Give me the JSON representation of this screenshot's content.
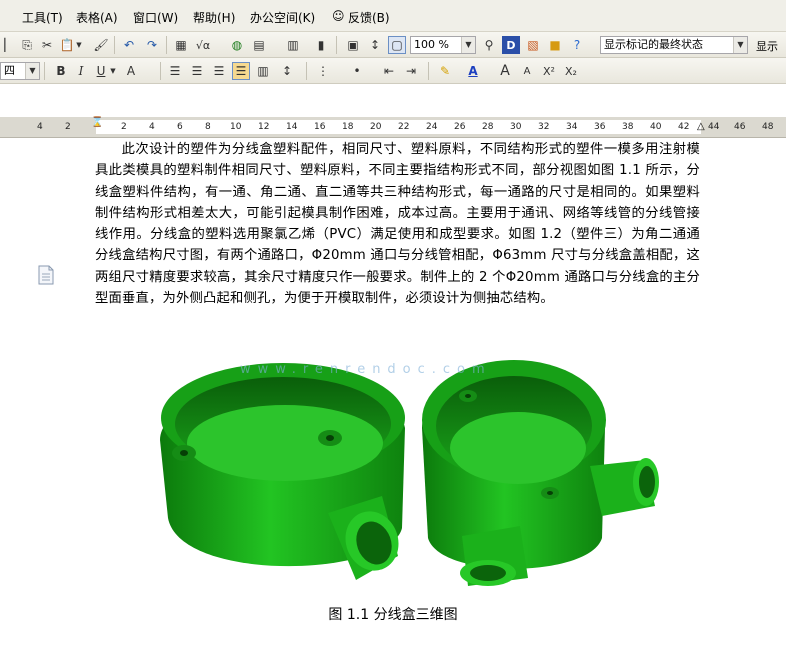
{
  "menubar": {
    "items": [
      "工具(T)",
      "表格(A)",
      "窗口(W)",
      "帮助(H)",
      "办公空间(K)",
      "反馈(B)"
    ]
  },
  "toolbar": {
    "zoom": "100 %",
    "markup_view": "显示标记的最终状态",
    "show_label": "显示",
    "font_size": "四"
  },
  "ruler": {
    "labels": [
      "4",
      "2",
      "2",
      "4",
      "6",
      "8",
      "10",
      "12",
      "14",
      "16",
      "18",
      "20",
      "22",
      "24",
      "26",
      "28",
      "30",
      "32",
      "34",
      "36",
      "38",
      "40",
      "42",
      "44",
      "46",
      "48"
    ]
  },
  "document": {
    "paragraph": "此次设计的塑件为分线盒塑料配件，相同尺寸、塑料原料，不同结构形式的塑件一模多用注射模具此类模具的塑料制件相同尺寸、塑料原料，不同主要指结构形式不同，部分视图如图 1.1 所示，分线盒塑料件结构，有一通、角二通、直二通等共三种结构形式，每一通路的尺寸是相同的。如果塑料制件结构形式相差太大，可能引起模具制作困难，成本过高。主要用于通讯、网络等线管的分线管接线作用。分线盒的塑料选用聚氯乙烯（PVC）满足使用和成型要求。如图 1.2（塑件三）为角二通通分线盒结构尺寸图，有两个通路口，Φ20mm 通口与分线管相配，Φ63mm 尺寸与分线盒盖相配，这两组尺寸精度要求较高，其余尺寸精度只作一般要求。制件上的 2 个Φ20mm 通路口与分线盒的主分型面垂直，为外侧凸起和侧孔，为便于开模取制件，必须设计为侧抽芯结构。",
    "watermark": "www.renrendoc.com",
    "caption": "图 1.1 分线盒三维图"
  },
  "colors": {
    "part_green": "#1fb81f",
    "part_dark": "#0a6e0a"
  }
}
